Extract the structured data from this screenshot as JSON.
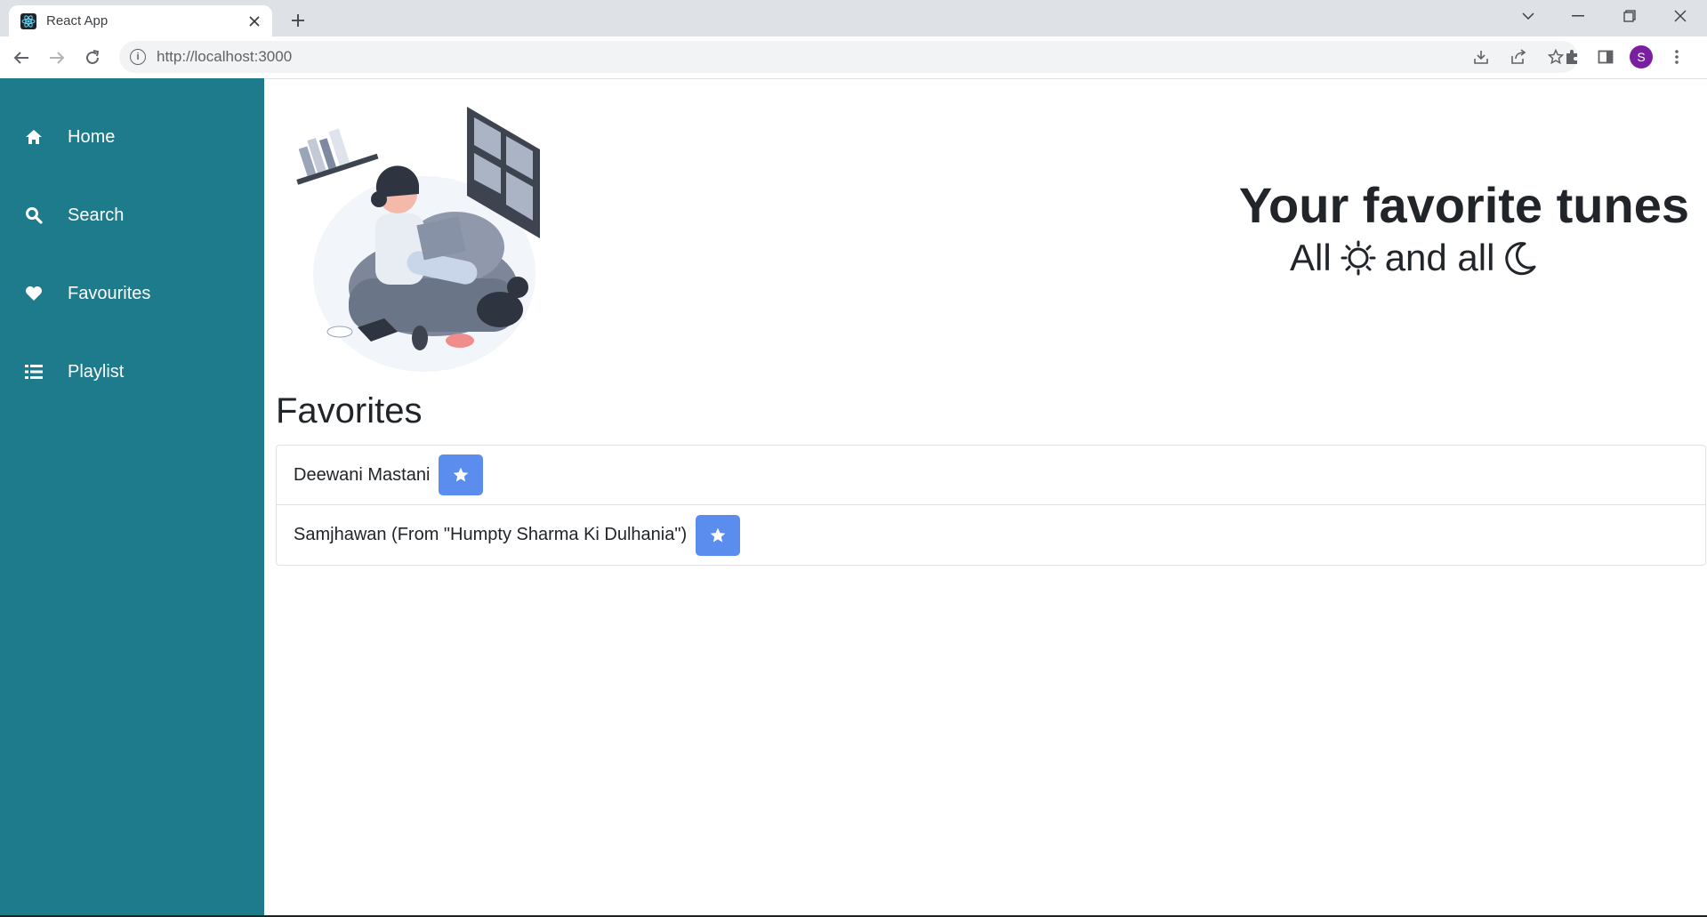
{
  "browser": {
    "tab_title": "React App",
    "url": "http://localhost:3000",
    "profile_initial": "S"
  },
  "sidebar": {
    "items": [
      {
        "label": "Home",
        "icon": "home-icon"
      },
      {
        "label": "Search",
        "icon": "search-icon"
      },
      {
        "label": "Favourites",
        "icon": "heart-icon"
      },
      {
        "label": "Playlist",
        "icon": "list-icon"
      }
    ]
  },
  "hero": {
    "title": "Your favorite tunes",
    "subtitle_part1": "All",
    "subtitle_part2": "and all",
    "sun_icon": "sun-icon",
    "moon_icon": "moon-icon"
  },
  "favorites": {
    "heading": "Favorites",
    "songs": [
      {
        "title": "Deewani Mastani"
      },
      {
        "title": "Samjhawan (From \"Humpty Sharma Ki Dulhania\")"
      }
    ]
  },
  "colors": {
    "sidebar": "#1e7b8c",
    "star_button": "#5b8def"
  }
}
